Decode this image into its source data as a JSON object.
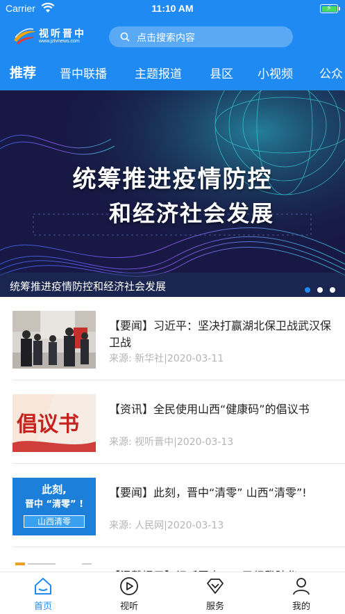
{
  "status_bar": {
    "carrier": "Carrier",
    "time": "11:10 AM"
  },
  "header": {
    "logo_name": "视听晋中",
    "logo_url": "www.jztvnews.com",
    "search_placeholder": "点击搜索内容",
    "brand_color": "#1f8af2"
  },
  "tabs": [
    {
      "label": "推荐",
      "active": true
    },
    {
      "label": "晋中联播",
      "active": false
    },
    {
      "label": "主题报道",
      "active": false
    },
    {
      "label": "县区",
      "active": false
    },
    {
      "label": "小视频",
      "active": false
    },
    {
      "label": "公众",
      "active": false
    }
  ],
  "banner": {
    "headline_line1": "统筹推进疫情防控",
    "headline_line2": "和经济社会发展",
    "caption": "统筹推进疫情防控和经济社会发展",
    "slide_count": 3,
    "active_slide": 1
  },
  "news": [
    {
      "title": "【要闻】习近平：坚决打赢湖北保卫战武汉保卫战",
      "meta": "来源: 新华社|2020-03-11",
      "thumb_icon": "photo-thumbnail"
    },
    {
      "title": "【资讯】全民使用山西“健康码”的倡议书",
      "meta": "来源: 视听晋中|2020-03-13",
      "thumb_icon": "proposal-thumbnail",
      "thumb_text": "倡议书"
    },
    {
      "title": "【要闻】此刻，晋中“清零” 山西“清零”!",
      "meta": "来源: 人民网|2020-03-13",
      "thumb_icon": "clearing-thumbnail",
      "thumb_line1": "此刻,",
      "thumb_line2": "晋中 “清零” !",
      "thumb_line3": "山西清零"
    },
    {
      "title": "【温馨提示】视听晋中……已经登陆华",
      "meta": "",
      "thumb_icon": "document-thumbnail"
    }
  ],
  "bottom_nav": [
    {
      "label": "首页",
      "icon": "home-icon",
      "active": true
    },
    {
      "label": "视听",
      "icon": "play-icon",
      "active": false
    },
    {
      "label": "服务",
      "icon": "service-icon",
      "active": false
    },
    {
      "label": "我的",
      "icon": "user-icon",
      "active": false
    }
  ]
}
